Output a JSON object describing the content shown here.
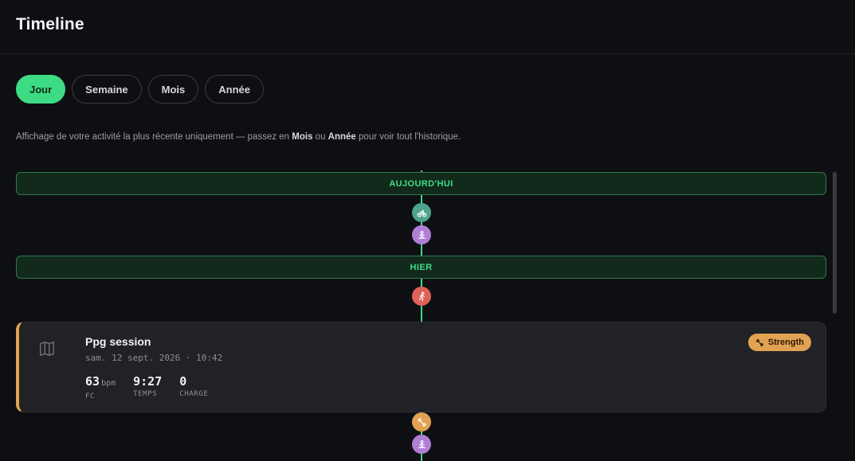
{
  "header": {
    "title": "Timeline"
  },
  "filters": {
    "items": [
      {
        "label": "Jour",
        "active": true
      },
      {
        "label": "Semaine",
        "active": false
      },
      {
        "label": "Mois",
        "active": false
      },
      {
        "label": "Année",
        "active": false
      }
    ]
  },
  "hint": {
    "before": "Affichage de votre activité la plus récente uniquement — passez en ",
    "bold1": "Mois",
    "middle": " ou ",
    "bold2": "Année",
    "after": " pour voir tout l'historique."
  },
  "timeline": {
    "today_label": "AUJOURD'HUI",
    "yesterday_label": "HIER",
    "dots": [
      {
        "icon": "bike-icon",
        "color": "#4ea38f"
      },
      {
        "icon": "meditation-icon",
        "color": "#b07ed6"
      },
      {
        "icon": "run-icon",
        "color": "#e0605a"
      },
      {
        "icon": "dumbbell-icon",
        "color": "#e2a253"
      },
      {
        "icon": "meditation-icon",
        "color": "#b07ed6"
      }
    ]
  },
  "card": {
    "icon": "map-icon",
    "title": "Ppg session",
    "date": "sam. 12 sept. 2026 · 10:42",
    "badge": {
      "label": "Strength",
      "icon": "dumbbell-icon",
      "color": "#e2a253"
    },
    "stats": [
      {
        "value": "63",
        "unit": "bpm",
        "label": "FC"
      },
      {
        "value": "9:27",
        "unit": "",
        "label": "TEMPS"
      },
      {
        "value": "0",
        "unit": "",
        "label": "CHARGE"
      }
    ]
  },
  "colors": {
    "accent": "#3ddc84",
    "background": "#0e0f12",
    "card": "#212226"
  }
}
